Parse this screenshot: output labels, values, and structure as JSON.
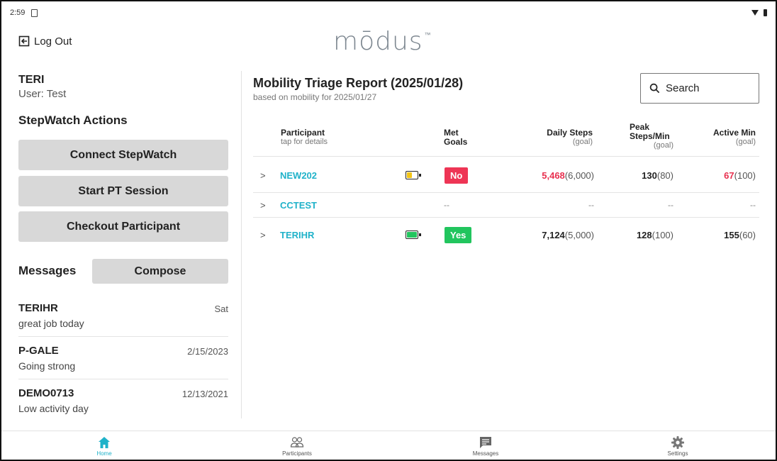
{
  "status_bar": {
    "time": "2:59"
  },
  "header": {
    "logout_label": "Log Out",
    "logo_text": "mōdus",
    "logo_tm": "™"
  },
  "user": {
    "name": "TERI",
    "line": "User: Test"
  },
  "actions": {
    "title": "StepWatch Actions",
    "connect": "Connect StepWatch",
    "start_pt": "Start PT Session",
    "checkout": "Checkout Participant"
  },
  "messages": {
    "title": "Messages",
    "compose": "Compose",
    "items": [
      {
        "from": "TERIHR",
        "date": "Sat",
        "text": "great job today"
      },
      {
        "from": "P-GALE",
        "date": "2/15/2023",
        "text": "Going strong"
      },
      {
        "from": "DEMO0713",
        "date": "12/13/2021",
        "text": "Low activity day"
      }
    ]
  },
  "report": {
    "title": "Mobility Triage Report (2025/01/28)",
    "subtitle": "based on mobility for 2025/01/27",
    "search_label": "Search",
    "columns": {
      "participant": "Participant",
      "participant_sub": "tap for details",
      "met_goals_1": "Met",
      "met_goals_2": "Goals",
      "daily_steps": "Daily Steps",
      "daily_steps_sub": "(goal)",
      "peak_1": "Peak",
      "peak_2": "Steps/Min",
      "peak_sub": "(goal)",
      "active": "Active Min",
      "active_sub": "(goal)"
    },
    "rows": [
      {
        "id": "NEW202",
        "battery": "low",
        "battery_color": "#f2c417",
        "battery_level": 0.5,
        "met": "No",
        "met_color": "#ee3555",
        "steps": "5,468",
        "steps_goal": "(6,000)",
        "steps_color": "#e8304f",
        "peak": "130",
        "peak_goal": "(80)",
        "peak_color": "#222222",
        "active": "67",
        "active_goal": "(100)",
        "active_color": "#e8304f"
      },
      {
        "id": "CCTEST",
        "battery": "none",
        "met": "--",
        "steps": "--",
        "peak": "--",
        "active": "--"
      },
      {
        "id": "TERIHR",
        "battery": "full",
        "battery_color": "#22c55e",
        "battery_level": 1.0,
        "met": "Yes",
        "met_color": "#22c55e",
        "steps": "7,124",
        "steps_goal": "(5,000)",
        "steps_color": "#222222",
        "peak": "128",
        "peak_goal": "(100)",
        "peak_color": "#222222",
        "active": "155",
        "active_goal": "(60)",
        "active_color": "#222222"
      }
    ]
  },
  "bottom_nav": {
    "items": [
      {
        "label": "Home",
        "icon": "home-icon",
        "active": true
      },
      {
        "label": "Participants",
        "icon": "people-icon",
        "active": false
      },
      {
        "label": "Messages",
        "icon": "message-icon",
        "active": false
      },
      {
        "label": "Settings",
        "icon": "gear-icon",
        "active": false
      }
    ],
    "active_color": "#1fb2c9"
  }
}
